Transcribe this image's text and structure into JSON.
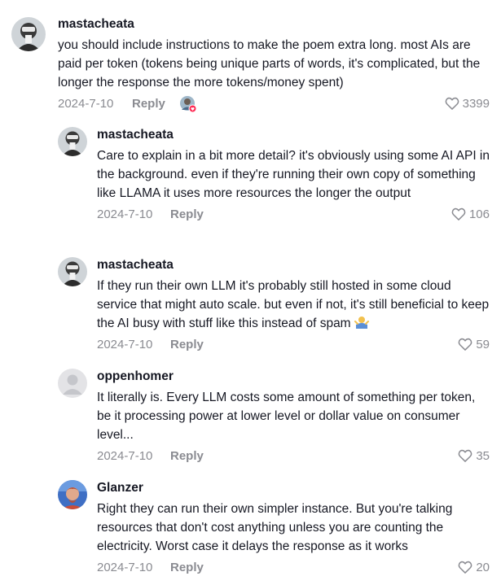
{
  "comments": [
    {
      "username": "mastacheata",
      "text": "you should include instructions to make the poem extra long. most AIs are paid per token (tokens being unique parts of words, it's complicated, but the longer the response the more tokens/money spent)",
      "date": "2024-7-10",
      "reply_label": "Reply",
      "likes": "3399",
      "avatar": "user-avatar-photo",
      "creator_liked": true
    },
    {
      "username": "mastacheata",
      "text": "Care to explain in a bit more detail? it's obviously using some AI API in the background. even if they're running their own copy of something like LLAMA it uses more resources the longer the output",
      "date": "2024-7-10",
      "reply_label": "Reply",
      "likes": "106",
      "avatar": "user-avatar-photo"
    },
    {
      "username": "mastacheata",
      "text": "If they run their own LLM it's probably still hosted in some cloud service that might auto scale. but even if not, it's still beneficial to keep the AI busy with stuff like this instead of spam",
      "text_emoji": "person-shrugging-emoji",
      "date": "2024-7-10",
      "reply_label": "Reply",
      "likes": "59",
      "avatar": "user-avatar-photo"
    },
    {
      "username": "oppenhomer",
      "text": "It literally is. Every LLM costs some amount of something per token, be it processing power at lower level or dollar value on consumer level...",
      "date": "2024-7-10",
      "reply_label": "Reply",
      "likes": "35",
      "avatar": "default-avatar"
    },
    {
      "username": "Glanzer",
      "text": "Right they can run their own simpler instance. But you're talking resources that don't cost anything unless you are counting the electricity. Worst case it delays the response as it works",
      "date": "2024-7-10",
      "reply_label": "Reply",
      "likes": "20",
      "avatar": "user-avatar-photo"
    }
  ],
  "colors": {
    "text": "#161823",
    "muted": "#8a8b91",
    "heart_outline": "#8a8b91",
    "creator_badge": "#fe2c55"
  }
}
